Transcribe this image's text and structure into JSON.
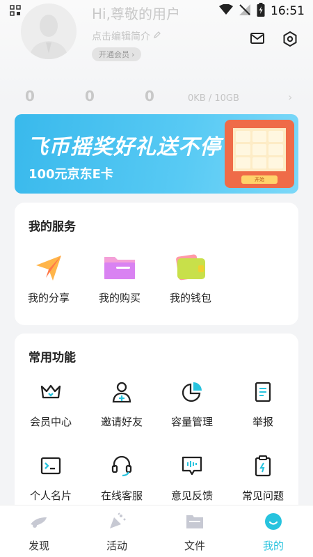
{
  "status_bar": {
    "time": "16:51"
  },
  "profile": {
    "greeting": "Hi,尊敬的用户",
    "bio": "点击编辑简介",
    "vip_button": "开通会员"
  },
  "stats": {
    "count_a": "0",
    "count_b": "0",
    "count_c": "0",
    "storage": "0KB / 10GB"
  },
  "banner": {
    "title": "飞币摇奖好礼送不停",
    "subtitle": "100元京东E卡",
    "machine_label": "开始"
  },
  "services": {
    "title": "我的服务",
    "items": [
      {
        "label": "我的分享",
        "icon": "share-paper-plane-icon"
      },
      {
        "label": "我的购买",
        "icon": "purchase-folder-icon"
      },
      {
        "label": "我的钱包",
        "icon": "wallet-icon"
      }
    ]
  },
  "functions": {
    "title": "常用功能",
    "items": [
      {
        "label": "会员中心",
        "icon": "crown-icon"
      },
      {
        "label": "邀请好友",
        "icon": "add-user-icon"
      },
      {
        "label": "容量管理",
        "icon": "pie-chart-icon"
      },
      {
        "label": "举报",
        "icon": "report-icon"
      },
      {
        "label": "个人名片",
        "icon": "terminal-card-icon"
      },
      {
        "label": "在线客服",
        "icon": "headset-icon"
      },
      {
        "label": "意见反馈",
        "icon": "feedback-icon"
      },
      {
        "label": "常见问题",
        "icon": "clipboard-icon"
      }
    ]
  },
  "tabbar": {
    "items": [
      {
        "label": "发现",
        "icon": "discover-icon"
      },
      {
        "label": "活动",
        "icon": "activity-icon"
      },
      {
        "label": "文件",
        "icon": "folder-icon"
      },
      {
        "label": "我的",
        "icon": "profile-icon",
        "active": true
      }
    ]
  },
  "colors": {
    "accent": "#27c3de",
    "background": "#f3f4f6",
    "banner": "#3fbcee"
  }
}
